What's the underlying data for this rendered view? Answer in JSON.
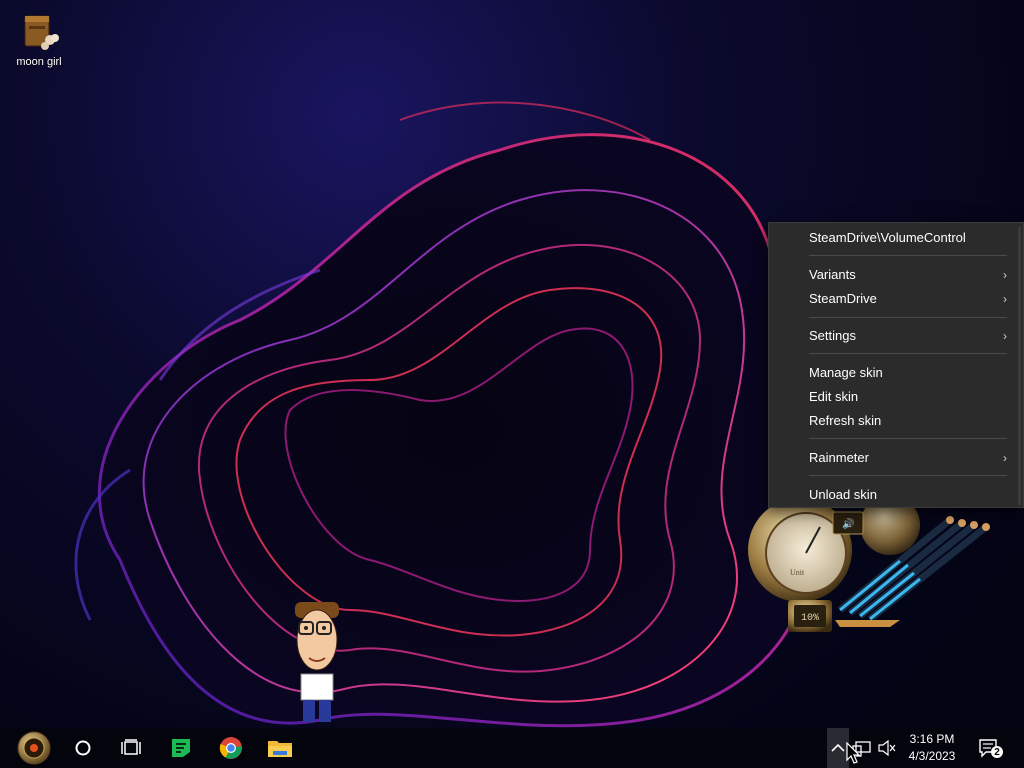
{
  "desktop": {
    "icons": [
      {
        "label": "moon girl",
        "icon": "chest-icon"
      }
    ]
  },
  "context_menu": {
    "items": [
      {
        "label": "SteamDrive\\VolumeControl",
        "submenu": false
      },
      {
        "label": "Variants",
        "submenu": true
      },
      {
        "label": "SteamDrive",
        "submenu": true
      },
      {
        "label": "Settings",
        "submenu": true
      },
      {
        "label": "Manage skin",
        "submenu": false
      },
      {
        "label": "Edit skin",
        "submenu": false
      },
      {
        "label": "Refresh skin",
        "submenu": false
      },
      {
        "label": "Rainmeter",
        "submenu": true
      },
      {
        "label": "Unload skin",
        "submenu": false
      }
    ],
    "submenu_arrow": "›"
  },
  "widget": {
    "gauge_labels": [
      "Unit"
    ],
    "percent_readout": "10%"
  },
  "taskbar": {
    "buttons": [
      {
        "name": "start-button",
        "icon": "steampunk-start-icon"
      },
      {
        "name": "cortana-button",
        "icon": "circle-icon"
      },
      {
        "name": "task-view-button",
        "icon": "task-view-icon"
      },
      {
        "name": "notes-app-button",
        "icon": "green-chat-icon"
      },
      {
        "name": "chrome-button",
        "icon": "chrome-icon"
      },
      {
        "name": "file-explorer-button",
        "icon": "folder-icon"
      }
    ],
    "tray": {
      "time": "3:16 PM",
      "date": "4/3/2023",
      "notification_count": "2"
    }
  },
  "colors": {
    "menu_bg": "#2b2b2b",
    "menu_separator": "#4a4a4a",
    "wallpaper_accent": "#c8205a",
    "taskbar_bg": "#04040c"
  }
}
